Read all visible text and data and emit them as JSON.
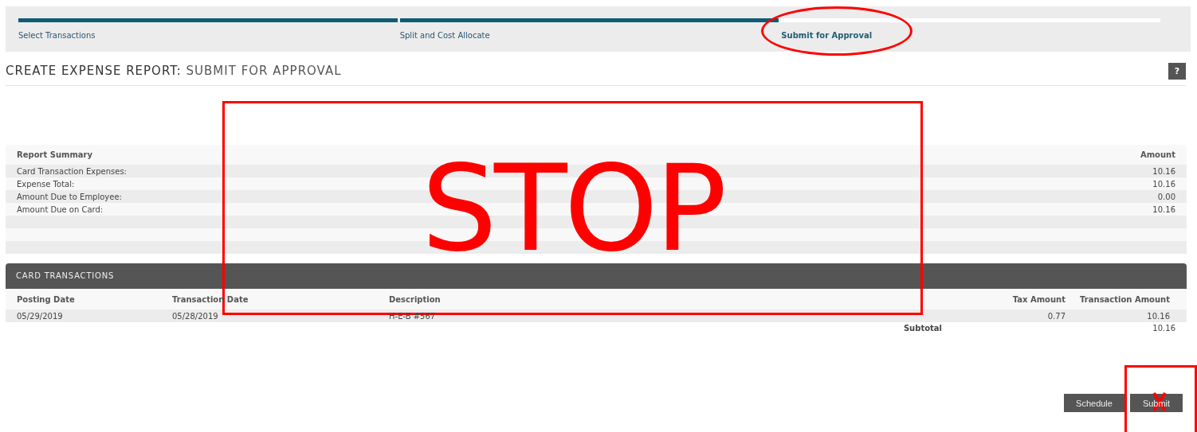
{
  "steps": [
    {
      "label": "Select Transactions",
      "completed": true,
      "selected": false
    },
    {
      "label": "Split and Cost Allocate",
      "completed": true,
      "selected": false
    },
    {
      "label": "Submit for Approval",
      "completed": false,
      "selected": true
    }
  ],
  "page_title": {
    "prefix": "CREATE EXPENSE REPORT:",
    "text": "SUBMIT FOR APPROVAL"
  },
  "help_button": "?",
  "report_summary": {
    "columns": [
      "Report Summary",
      "Amount"
    ],
    "rows": [
      {
        "label": "Card Transaction Expenses:",
        "amount": "10.16"
      },
      {
        "label": "Expense Total:",
        "amount": "10.16"
      },
      {
        "label": "Amount Due to Employee:",
        "amount": "0.00"
      },
      {
        "label": "Amount Due on Card:",
        "amount": "10.16"
      }
    ]
  },
  "card_transactions": {
    "title": "CARD TRANSACTIONS",
    "columns": [
      "Posting Date",
      "Transaction Date",
      "Description",
      "Tax Amount",
      "Transaction Amount"
    ],
    "rows": [
      [
        "05/29/2019",
        "05/28/2019",
        "H-E-B #567",
        "0.77",
        "10.16"
      ]
    ],
    "subtotal_label": "Subtotal",
    "subtotal": "10.16"
  },
  "buttons": [
    "Schedule",
    "Submit"
  ],
  "annotations": [
    {
      "kind": "box",
      "text": "STOP"
    },
    {
      "kind": "ellipse"
    },
    {
      "kind": "crossed-box"
    }
  ]
}
